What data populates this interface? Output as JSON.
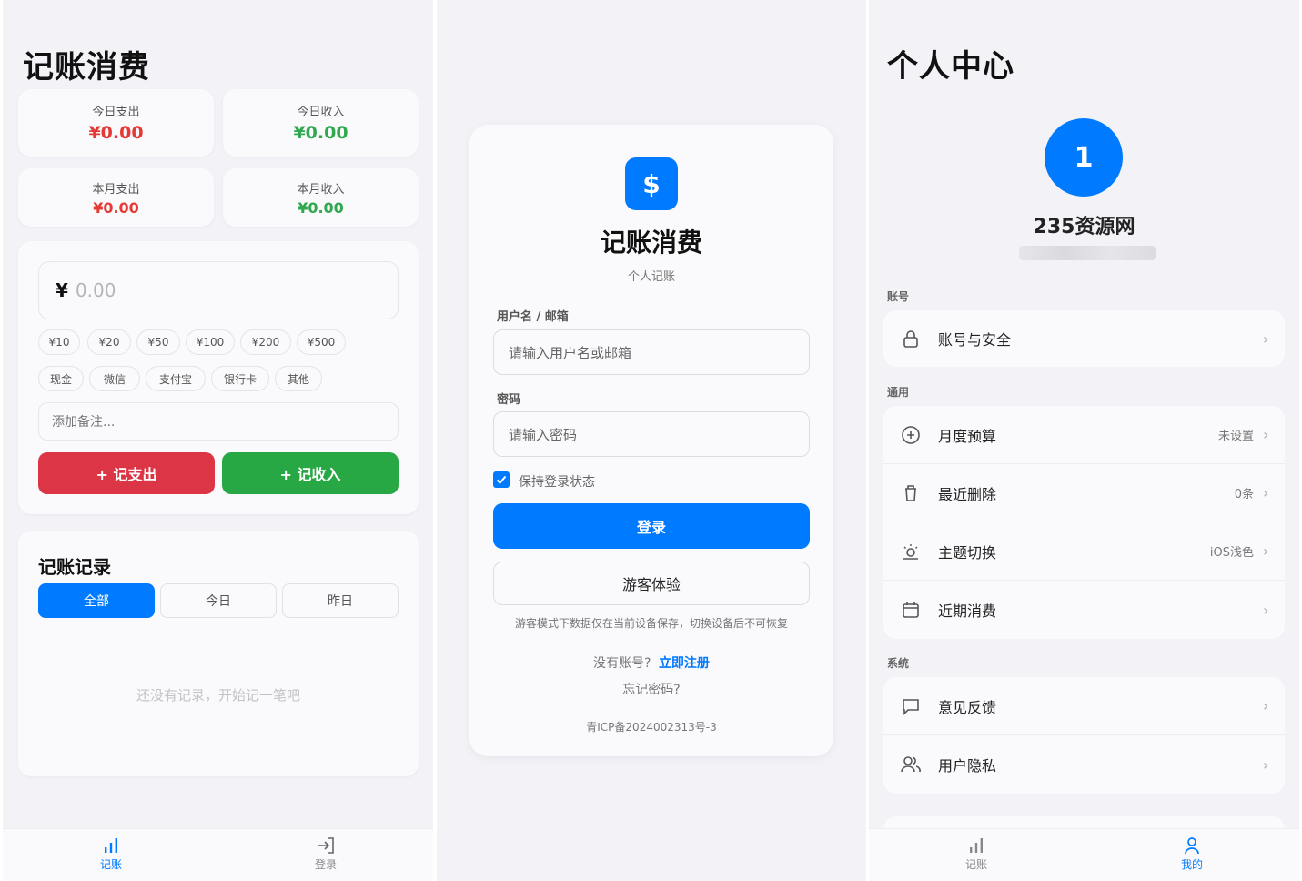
{
  "colors": {
    "accent": "#007aff",
    "red": "#e53935",
    "green": "#2fa84f",
    "expense_btn": "#dc3545",
    "income_btn": "#28a745"
  },
  "ledger": {
    "title": "记账消费",
    "stats": [
      {
        "label": "今日支出",
        "value": "¥0.00"
      },
      {
        "label": "今日收入",
        "value": "¥0.00"
      },
      {
        "label": "本月支出",
        "value": "¥0.00"
      },
      {
        "label": "本月收入",
        "value": "¥0.00"
      }
    ],
    "currency_symbol": "¥",
    "amount_placeholder": "0.00",
    "quick_amounts": [
      "¥10",
      "¥20",
      "¥50",
      "¥100",
      "¥200",
      "¥500"
    ],
    "payment_methods": [
      "现金",
      "微信",
      "支付宝",
      "银行卡",
      "其他"
    ],
    "note_placeholder": "添加备注...",
    "expense_button": "+ 记支出",
    "income_button": "+ 记收入",
    "records_title": "记账记录",
    "filters": [
      "全部",
      "今日",
      "昨日"
    ],
    "empty_text": "还没有记录，开始记一笔吧"
  },
  "login": {
    "logo_glyph": "$",
    "app_name": "记账消费",
    "subtitle": "个人记账",
    "username_label": "用户名 / 邮箱",
    "username_placeholder": "请输入用户名或邮箱",
    "password_label": "密码",
    "password_placeholder": "请输入密码",
    "remember_label": "保持登录状态",
    "login_button": "登录",
    "guest_button": "游客体验",
    "guest_note": "游客模式下数据仅在当前设备保存，切换设备后不可恢复",
    "no_account": "没有账号?",
    "register_link": "立即注册",
    "forgot": "忘记密码?",
    "icp": "青ICP备2024002313号-3"
  },
  "profile": {
    "title": "个人中心",
    "avatar_text": "1",
    "username": "235资源网",
    "sections": [
      {
        "label": "账号",
        "items": [
          {
            "icon": "lock-icon",
            "text": "账号与安全",
            "value": ""
          }
        ]
      },
      {
        "label": "通用",
        "items": [
          {
            "icon": "plus-circle-icon",
            "text": "月度预算",
            "value": "未设置"
          },
          {
            "icon": "trash-icon",
            "text": "最近删除",
            "value": "0条"
          },
          {
            "icon": "sun-icon",
            "text": "主题切换",
            "value": "iOS浅色"
          },
          {
            "icon": "calendar-icon",
            "text": "近期消费",
            "value": ""
          }
        ]
      },
      {
        "label": "系统",
        "items": [
          {
            "icon": "chat-icon",
            "text": "意见反馈",
            "value": ""
          },
          {
            "icon": "users-icon",
            "text": "用户隐私",
            "value": ""
          }
        ]
      }
    ]
  },
  "tabbar1": {
    "tabs": [
      "记账",
      "登录"
    ]
  },
  "tabbar3": {
    "tabs": [
      "记账",
      "我的"
    ]
  }
}
